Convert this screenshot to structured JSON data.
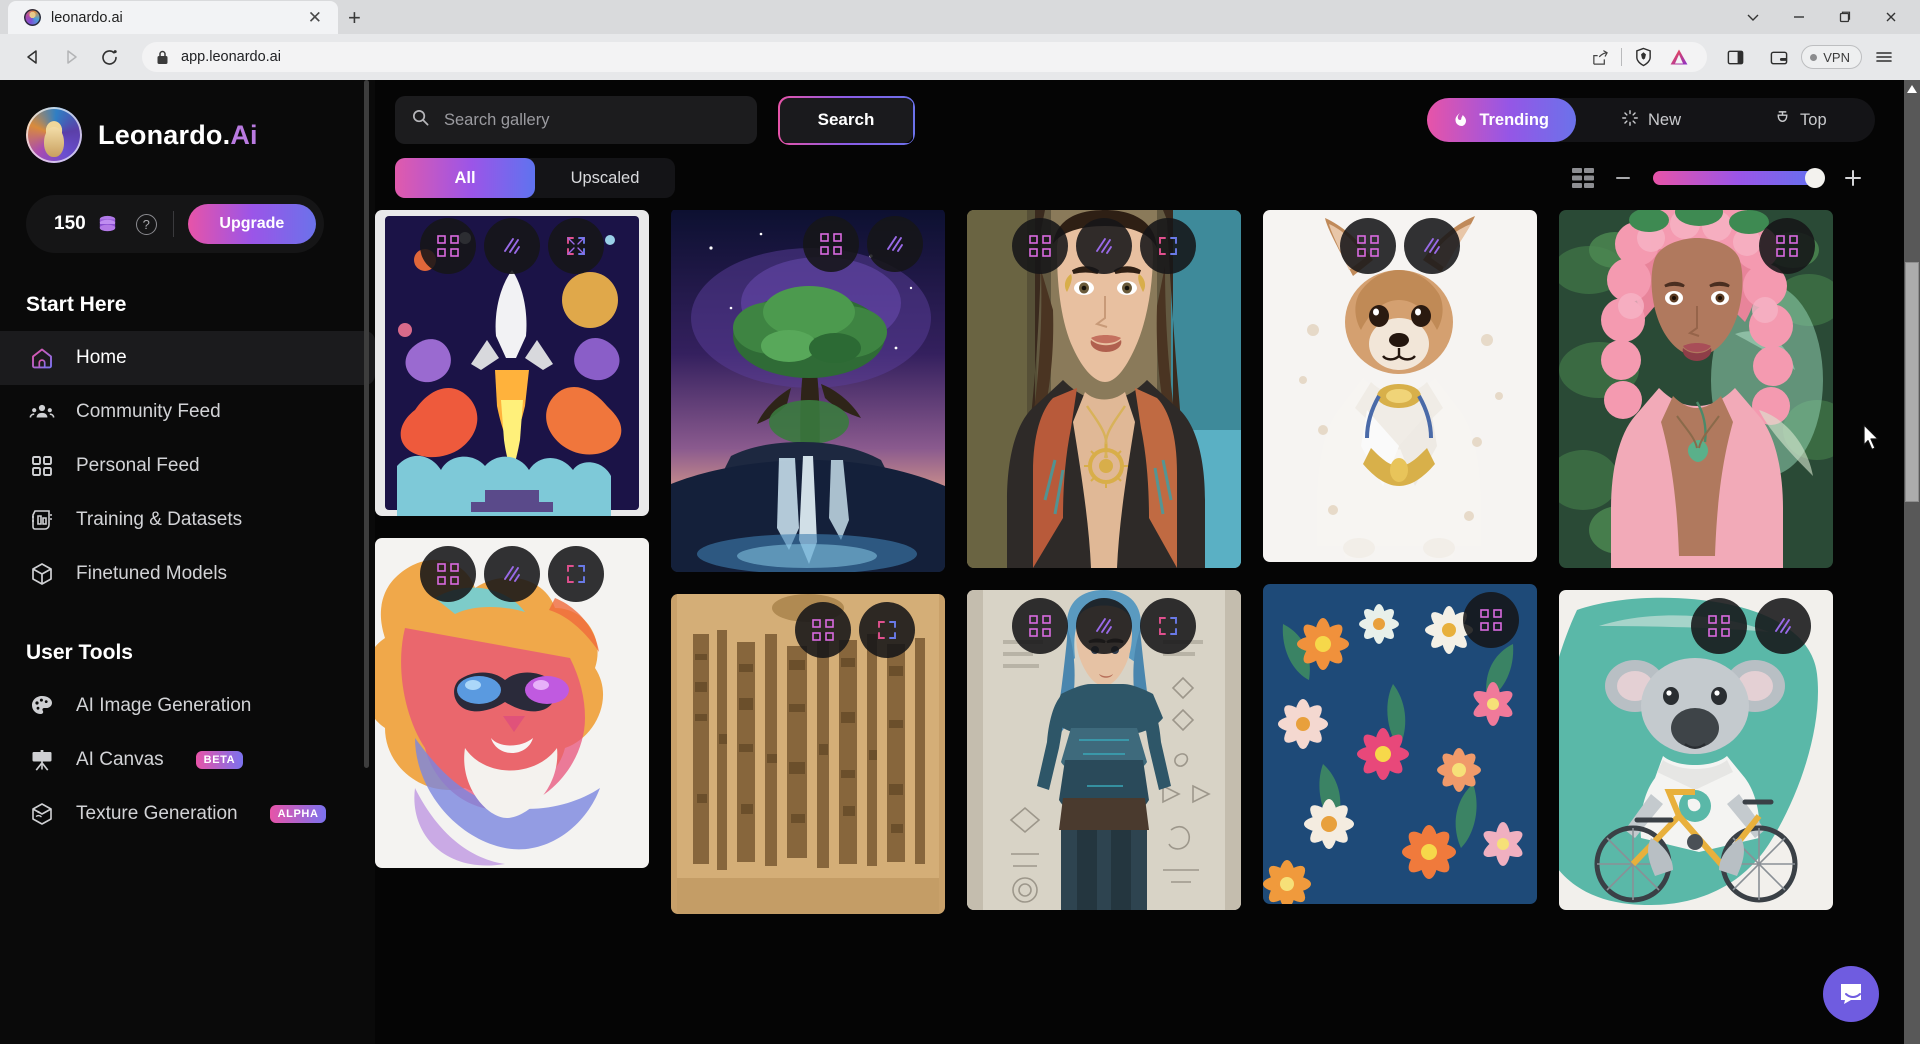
{
  "browser": {
    "tab": {
      "title": "leonardo.ai",
      "favicon_icon": "leonardo-favicon",
      "close_icon": "close-icon"
    },
    "new_tab_icon": "plus-icon",
    "window_controls": [
      {
        "name": "chevron-down-icon",
        "glyph": "⌄"
      },
      {
        "name": "minimize-icon",
        "glyph": "—"
      },
      {
        "name": "maximize-icon",
        "glyph": "❐"
      },
      {
        "name": "close-icon",
        "glyph": "✕"
      }
    ],
    "nav": {
      "back_icon": "back-arrow-icon",
      "forward_icon": "forward-arrow-icon",
      "reload_icon": "reload-icon",
      "bookmark_icon": "bookmark-icon"
    },
    "url": "app.leonardo.ai",
    "url_lock_icon": "lock-icon",
    "url_right_icons": [
      "share-icon",
      "brave-shields-icon",
      "brave-rewards-icon"
    ],
    "toolbar_icons": [
      "sidebar-panel-icon",
      "wallet-icon"
    ],
    "vpn_label": "VPN",
    "menu_icon": "hamburger-menu-icon"
  },
  "sidebar": {
    "brand": {
      "name": "Leonardo.",
      "suffix": "Ai"
    },
    "credits": {
      "amount": "150",
      "coin_icon": "coins-icon",
      "help_icon": "help-circle-icon",
      "upgrade_label": "Upgrade"
    },
    "sections": [
      {
        "title": "Start Here",
        "items": [
          {
            "label": "Home",
            "icon": "home-icon",
            "active": true,
            "badge": ""
          },
          {
            "label": "Community Feed",
            "icon": "people-icon",
            "active": false,
            "badge": ""
          },
          {
            "label": "Personal Feed",
            "icon": "grid-squares-icon",
            "active": false,
            "badge": ""
          },
          {
            "label": "Training & Datasets",
            "icon": "training-chip-icon",
            "active": false,
            "badge": ""
          },
          {
            "label": "Finetuned Models",
            "icon": "cube-icon",
            "active": false,
            "badge": ""
          }
        ]
      },
      {
        "title": "User Tools",
        "items": [
          {
            "label": "AI Image Generation",
            "icon": "palette-icon",
            "active": false,
            "badge": ""
          },
          {
            "label": "AI Canvas",
            "icon": "easel-icon",
            "active": false,
            "badge": "BETA"
          },
          {
            "label": "Texture Generation",
            "icon": "texture-cube-icon",
            "active": false,
            "badge": "ALPHA"
          }
        ]
      }
    ]
  },
  "main": {
    "search": {
      "placeholder": "Search gallery",
      "icon": "search-icon",
      "button_label": "Search"
    },
    "sort_tabs": [
      {
        "label": "Trending",
        "icon": "flame-icon",
        "active": true
      },
      {
        "label": "New",
        "icon": "sparkle-icon",
        "active": false
      },
      {
        "label": "Top",
        "icon": "trophy-icon",
        "active": false
      }
    ],
    "filter_tabs": [
      {
        "label": "All",
        "active": true
      },
      {
        "label": "Upscaled",
        "active": false
      }
    ],
    "view_controls": {
      "grid_icon": "grid-layout-icon",
      "zoom_out_icon": "minus-icon",
      "zoom_in_icon": "plus-icon",
      "slider_value": 100
    },
    "card_actions": [
      "variations-icon",
      "motion-icon",
      "expand-icon"
    ],
    "gallery_columns": [
      {
        "cards": [
          {
            "name": "rocket-launch-illustration",
            "actions": [
              "variations-icon",
              "motion-icon",
              "expand-icon"
            ]
          },
          {
            "name": "colorful-lion-sunglasses",
            "actions": [
              "variations-icon",
              "motion-icon",
              "expand-icon"
            ]
          }
        ]
      },
      {
        "cards": [
          {
            "name": "fantasy-tree-waterfall-galaxy",
            "actions": [
              "variations-icon",
              "motion-icon"
            ]
          },
          {
            "name": "egyptian-hieroglyph-scroll",
            "actions": [
              "variations-icon",
              "expand-icon"
            ]
          }
        ]
      },
      {
        "cards": [
          {
            "name": "portrait-woman-boho-necklace",
            "actions": [
              "variations-icon",
              "motion-icon",
              "expand-icon"
            ]
          },
          {
            "name": "blue-haired-fantasy-warrior",
            "actions": [
              "variations-icon",
              "motion-icon",
              "expand-icon"
            ]
          }
        ]
      },
      {
        "cards": [
          {
            "name": "chihuahua-watercolor",
            "actions": [
              "variations-icon",
              "motion-icon"
            ]
          },
          {
            "name": "floral-pattern-tile",
            "actions": [
              "variations-icon"
            ]
          }
        ]
      },
      {
        "cards": [
          {
            "name": "pink-hair-fairy-portrait",
            "actions": [
              "variations-icon"
            ]
          },
          {
            "name": "koala-on-bicycle",
            "actions": [
              "variations-icon",
              "motion-icon"
            ]
          }
        ]
      }
    ],
    "support_widget_icon": "intercom-chat-icon"
  },
  "colors": {
    "accent_pink": "#e754a8",
    "accent_purple": "#9b55e8",
    "accent_blue": "#6b72ea",
    "sidebar_bg": "#0a0a0a",
    "main_bg": "#050505"
  }
}
